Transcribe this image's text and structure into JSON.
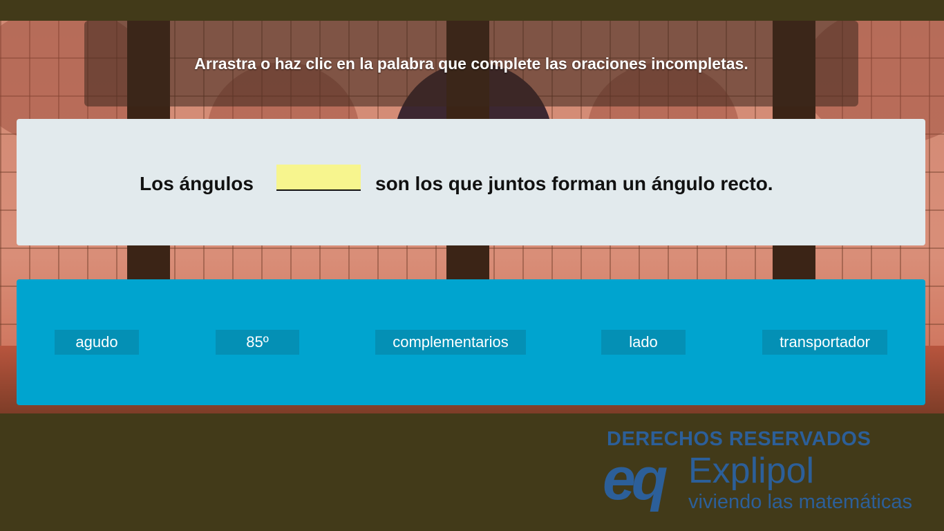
{
  "instruction": "Arrastra o haz clic en la palabra que complete las oraciones incompletas.",
  "sentence": {
    "before": "Los ángulos",
    "after": "son los que juntos forman un ángulo recto."
  },
  "options": [
    "agudo",
    "85º",
    "complementarios",
    "lado",
    "transportador"
  ],
  "watermark": {
    "rights": "DERECHOS RESERVADOS",
    "logo_mark": "eq",
    "brand": "Explipol",
    "tagline": "viviendo las matemáticas"
  },
  "colors": {
    "blank": "#f7f58e",
    "bank": "#00a4cf",
    "option_bg": "#0490b5",
    "watermark": "#2c5f99"
  }
}
